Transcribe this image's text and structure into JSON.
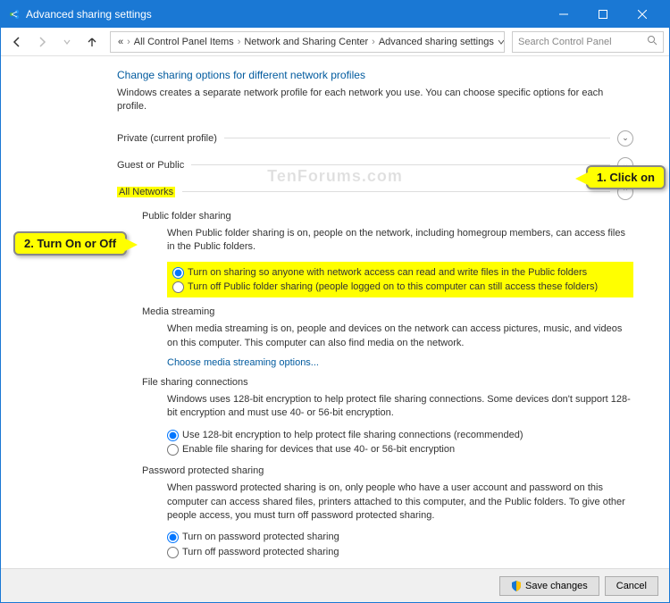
{
  "window": {
    "title": "Advanced sharing settings"
  },
  "toolbar": {
    "crumbs": [
      "«",
      "All Control Panel Items",
      "Network and Sharing Center",
      "Advanced sharing settings"
    ],
    "search_placeholder": "Search Control Panel"
  },
  "page": {
    "heading": "Change sharing options for different network profiles",
    "description": "Windows creates a separate network profile for each network you use. You can choose specific options for each profile."
  },
  "sections": {
    "private": {
      "label": "Private (current profile)"
    },
    "guest": {
      "label": "Guest or Public"
    },
    "all": {
      "label": "All Networks"
    }
  },
  "public_folder": {
    "title": "Public folder sharing",
    "desc": "When Public folder sharing is on, people on the network, including homegroup members, can access files in the Public folders.",
    "opt_on": "Turn on sharing so anyone with network access can read and write files in the Public folders",
    "opt_off": "Turn off Public folder sharing (people logged on to this computer can still access these folders)"
  },
  "media": {
    "title": "Media streaming",
    "desc": "When media streaming is on, people and devices on the network can access pictures, music, and videos on this computer. This computer can also find media on the network.",
    "link": "Choose media streaming options..."
  },
  "file_conn": {
    "title": "File sharing connections",
    "desc": "Windows uses 128-bit encryption to help protect file sharing connections. Some devices don't support 128-bit encryption and must use 40- or 56-bit encryption.",
    "opt_128": "Use 128-bit encryption to help protect file sharing connections (recommended)",
    "opt_4056": "Enable file sharing for devices that use 40- or 56-bit encryption"
  },
  "password": {
    "title": "Password protected sharing",
    "desc": "When password protected sharing is on, only people who have a user account and password on this computer can access shared files, printers attached to this computer, and the Public folders. To give other people access, you must turn off password protected sharing.",
    "opt_on": "Turn on password protected sharing",
    "opt_off": "Turn off password protected sharing"
  },
  "footer": {
    "save": "Save changes",
    "cancel": "Cancel"
  },
  "callouts": {
    "c1": "1. Click on",
    "c2": "2. Turn On or Off"
  },
  "watermark": "TenForums.com"
}
